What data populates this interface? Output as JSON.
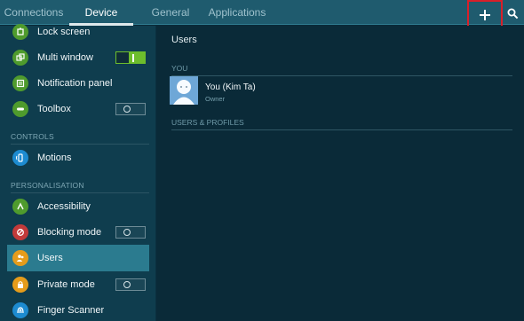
{
  "tabs": [
    {
      "label": "Connections"
    },
    {
      "label": "Device"
    },
    {
      "label": "General"
    },
    {
      "label": "Applications"
    }
  ],
  "active_tab": "Device",
  "actions": {
    "add": {
      "icon": "plus-icon"
    },
    "search": {
      "icon": "search-icon"
    }
  },
  "sidebar": {
    "items": [
      {
        "label": "Lock screen",
        "icon": "lock-screen-icon",
        "color": "#4f9b2d"
      },
      {
        "label": "Multi window",
        "icon": "multi-window-icon",
        "color": "#4f9b2d",
        "toggle": "on"
      },
      {
        "label": "Notification panel",
        "icon": "notification-panel-icon",
        "color": "#4f9b2d"
      },
      {
        "label": "Toolbox",
        "icon": "toolbox-icon",
        "color": "#4f9b2d",
        "toggle": "off"
      },
      {
        "label": "Motions",
        "icon": "motions-icon",
        "color": "#1d8bd0"
      },
      {
        "label": "Accessibility",
        "icon": "accessibility-icon",
        "color": "#4f9b2d"
      },
      {
        "label": "Blocking mode",
        "icon": "blocking-mode-icon",
        "color": "#c23a3a",
        "toggle": "off"
      },
      {
        "label": "Users",
        "icon": "users-icon",
        "color": "#e59c1b",
        "selected": true
      },
      {
        "label": "Private mode",
        "icon": "private-mode-icon",
        "color": "#e59c1b",
        "toggle": "off"
      },
      {
        "label": "Finger Scanner",
        "icon": "finger-scanner-icon",
        "color": "#1d8bd0"
      }
    ],
    "sections": {
      "controls": "CONTROLS",
      "personalisation": "PERSONALISATION"
    }
  },
  "main": {
    "title": "Users",
    "you_section": "YOU",
    "user": {
      "name": "You (Kim Ta)",
      "role": "Owner"
    },
    "users_section": "USERS & PROFILES"
  },
  "colors": {
    "topbar": "#1f5b6e",
    "sidebar": "#0f3d4e",
    "main": "#0a2a38",
    "selected": "#2b7b8f",
    "highlight_box": "#d8202a"
  }
}
